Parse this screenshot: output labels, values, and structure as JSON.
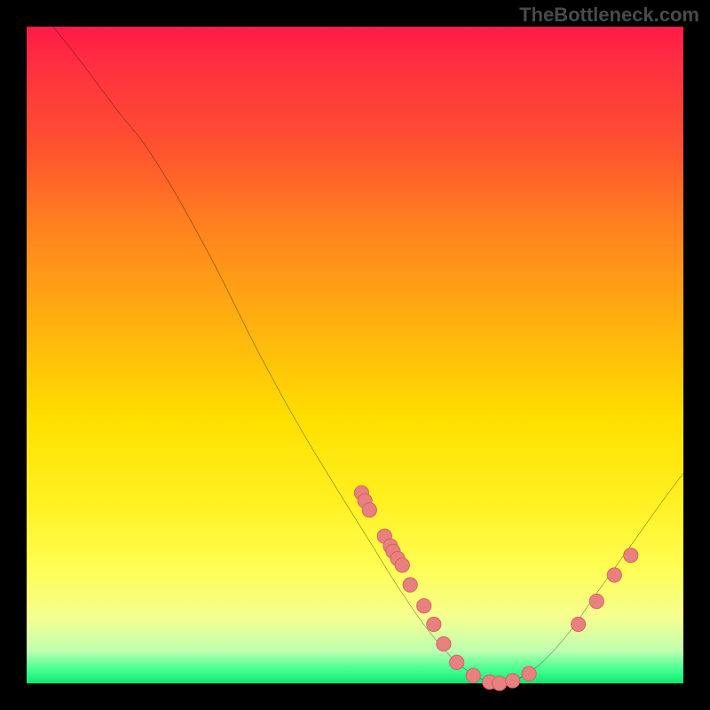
{
  "watermark": "TheBottleneck.com",
  "chart_data": {
    "type": "line",
    "title": "",
    "xlabel": "",
    "ylabel": "",
    "xlim": [
      0,
      100
    ],
    "ylim": [
      0,
      100
    ],
    "curve": [
      {
        "x": 4,
        "y": 100
      },
      {
        "x": 8,
        "y": 95
      },
      {
        "x": 14,
        "y": 87
      },
      {
        "x": 18,
        "y": 82
      },
      {
        "x": 23,
        "y": 74
      },
      {
        "x": 29,
        "y": 63
      },
      {
        "x": 35,
        "y": 51
      },
      {
        "x": 41,
        "y": 40
      },
      {
        "x": 47,
        "y": 30
      },
      {
        "x": 52,
        "y": 22
      },
      {
        "x": 57,
        "y": 14
      },
      {
        "x": 62,
        "y": 7
      },
      {
        "x": 67,
        "y": 2
      },
      {
        "x": 72,
        "y": 0
      },
      {
        "x": 77,
        "y": 2
      },
      {
        "x": 82,
        "y": 7
      },
      {
        "x": 87,
        "y": 14
      },
      {
        "x": 92,
        "y": 21
      },
      {
        "x": 97,
        "y": 28
      },
      {
        "x": 100,
        "y": 32
      }
    ],
    "markers": [
      {
        "x": 51.0,
        "y": 29.0
      },
      {
        "x": 51.5,
        "y": 27.8
      },
      {
        "x": 52.2,
        "y": 26.4
      },
      {
        "x": 54.5,
        "y": 22.4
      },
      {
        "x": 55.4,
        "y": 20.9
      },
      {
        "x": 55.8,
        "y": 20.1
      },
      {
        "x": 56.5,
        "y": 19.0
      },
      {
        "x": 57.2,
        "y": 18.0
      },
      {
        "x": 58.4,
        "y": 15.0
      },
      {
        "x": 60.5,
        "y": 11.8
      },
      {
        "x": 62.0,
        "y": 9.0
      },
      {
        "x": 63.5,
        "y": 6.0
      },
      {
        "x": 65.5,
        "y": 3.2
      },
      {
        "x": 68.0,
        "y": 1.2
      },
      {
        "x": 70.5,
        "y": 0.2
      },
      {
        "x": 72.0,
        "y": 0.0
      },
      {
        "x": 74.0,
        "y": 0.4
      },
      {
        "x": 76.5,
        "y": 1.5
      },
      {
        "x": 84.0,
        "y": 9.0
      },
      {
        "x": 86.8,
        "y": 12.5
      },
      {
        "x": 89.5,
        "y": 16.5
      },
      {
        "x": 92.0,
        "y": 19.5
      }
    ],
    "gradient_stops": [
      {
        "pos": 0,
        "color": "#ff1a4a"
      },
      {
        "pos": 60,
        "color": "#ffe000"
      },
      {
        "pos": 100,
        "color": "#10e870"
      }
    ],
    "colors": {
      "curve": "#000000",
      "marker_fill": "#e88080",
      "marker_stroke": "#d06060"
    }
  }
}
